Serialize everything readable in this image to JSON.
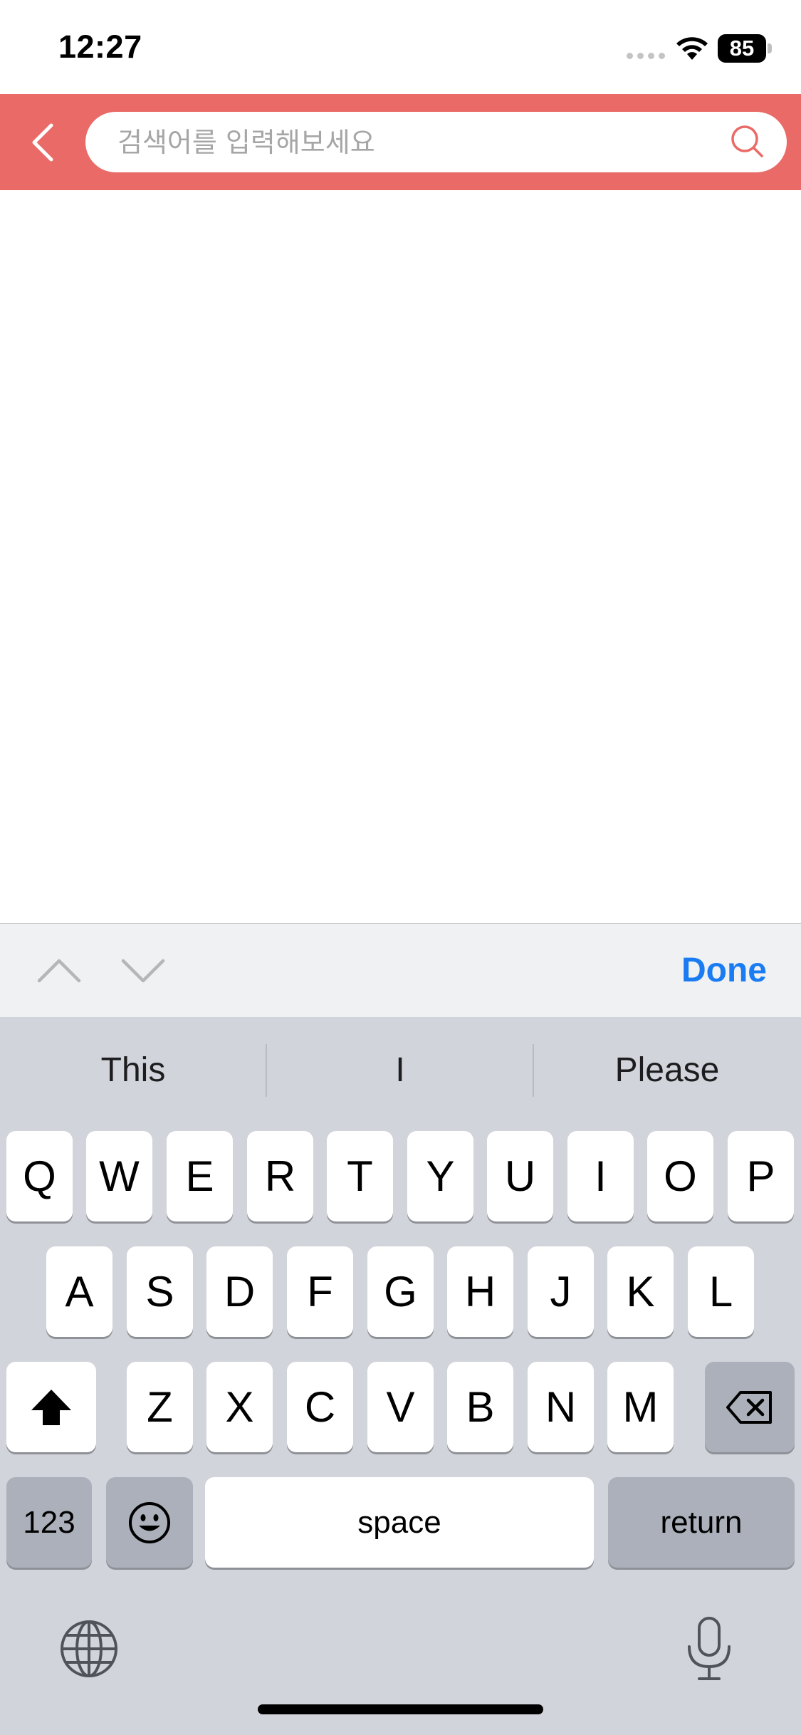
{
  "status_bar": {
    "time": "12:27",
    "battery": "85"
  },
  "search": {
    "placeholder": "검색어를 입력해보세요",
    "value": "",
    "back_icon": "chevron-left-icon",
    "search_icon": "magnifier-icon",
    "header_color": "#e96a66"
  },
  "keyboard_toolbar": {
    "done_label": "Done",
    "prev_icon": "chevron-up-icon",
    "next_icon": "chevron-down-icon",
    "accent_color": "#1a7cf2"
  },
  "keyboard": {
    "suggestions": [
      "This",
      "I",
      "Please"
    ],
    "row1": [
      "Q",
      "W",
      "E",
      "R",
      "T",
      "Y",
      "U",
      "I",
      "O",
      "P"
    ],
    "row2": [
      "A",
      "S",
      "D",
      "F",
      "G",
      "H",
      "J",
      "K",
      "L"
    ],
    "row3": [
      "Z",
      "X",
      "C",
      "V",
      "B",
      "N",
      "M"
    ],
    "numbers_label": "123",
    "space_label": "space",
    "return_label": "return"
  }
}
